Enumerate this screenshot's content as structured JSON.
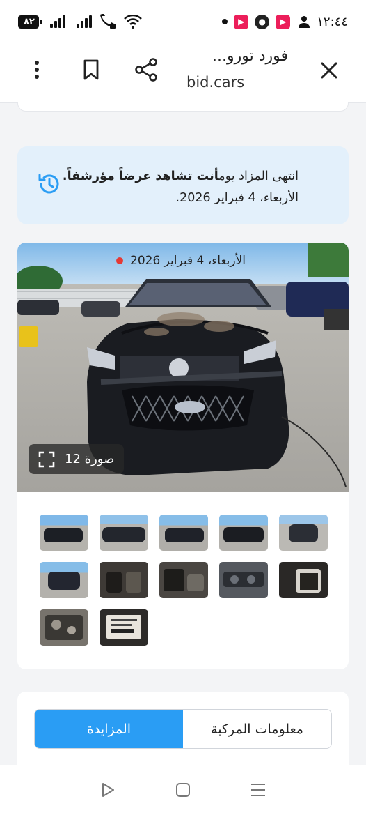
{
  "status_bar": {
    "battery": "٨٢",
    "time": "١٢:٤٤",
    "app_icons": [
      "video-app-icon",
      "record-app-icon",
      "video-app-icon",
      "notification-icon"
    ]
  },
  "browser": {
    "title": "فورد تورو...",
    "url": "bid.cars"
  },
  "notice": {
    "line1_prefix": "انتهى المزاد يوم",
    "line1_bold": "أنت تشاهد عرضاً مؤرشفاً.",
    "line2": "الأربعاء، 4 فبراير 2026."
  },
  "gallery": {
    "date_overlay": "الأربعاء، 4 فبراير 2026",
    "photo_count": "12 صورة",
    "thumbnails": [
      {
        "kind": "car-front-left"
      },
      {
        "kind": "car-side"
      },
      {
        "kind": "car-rear-left"
      },
      {
        "kind": "car-rear-right"
      },
      {
        "kind": "car-front"
      },
      {
        "kind": "car-rear"
      },
      {
        "kind": "interior-seats"
      },
      {
        "kind": "interior-front"
      },
      {
        "kind": "dashboard"
      },
      {
        "kind": "interior-rear"
      },
      {
        "kind": "engine"
      },
      {
        "kind": "vin-label"
      }
    ]
  },
  "tabs": {
    "vehicle_info": "معلومات المركبة",
    "auction": "المزايدة"
  },
  "colors": {
    "accent": "#2a9df4",
    "notice_bg": "#e3f0fb",
    "live_dot": "#e53935"
  }
}
